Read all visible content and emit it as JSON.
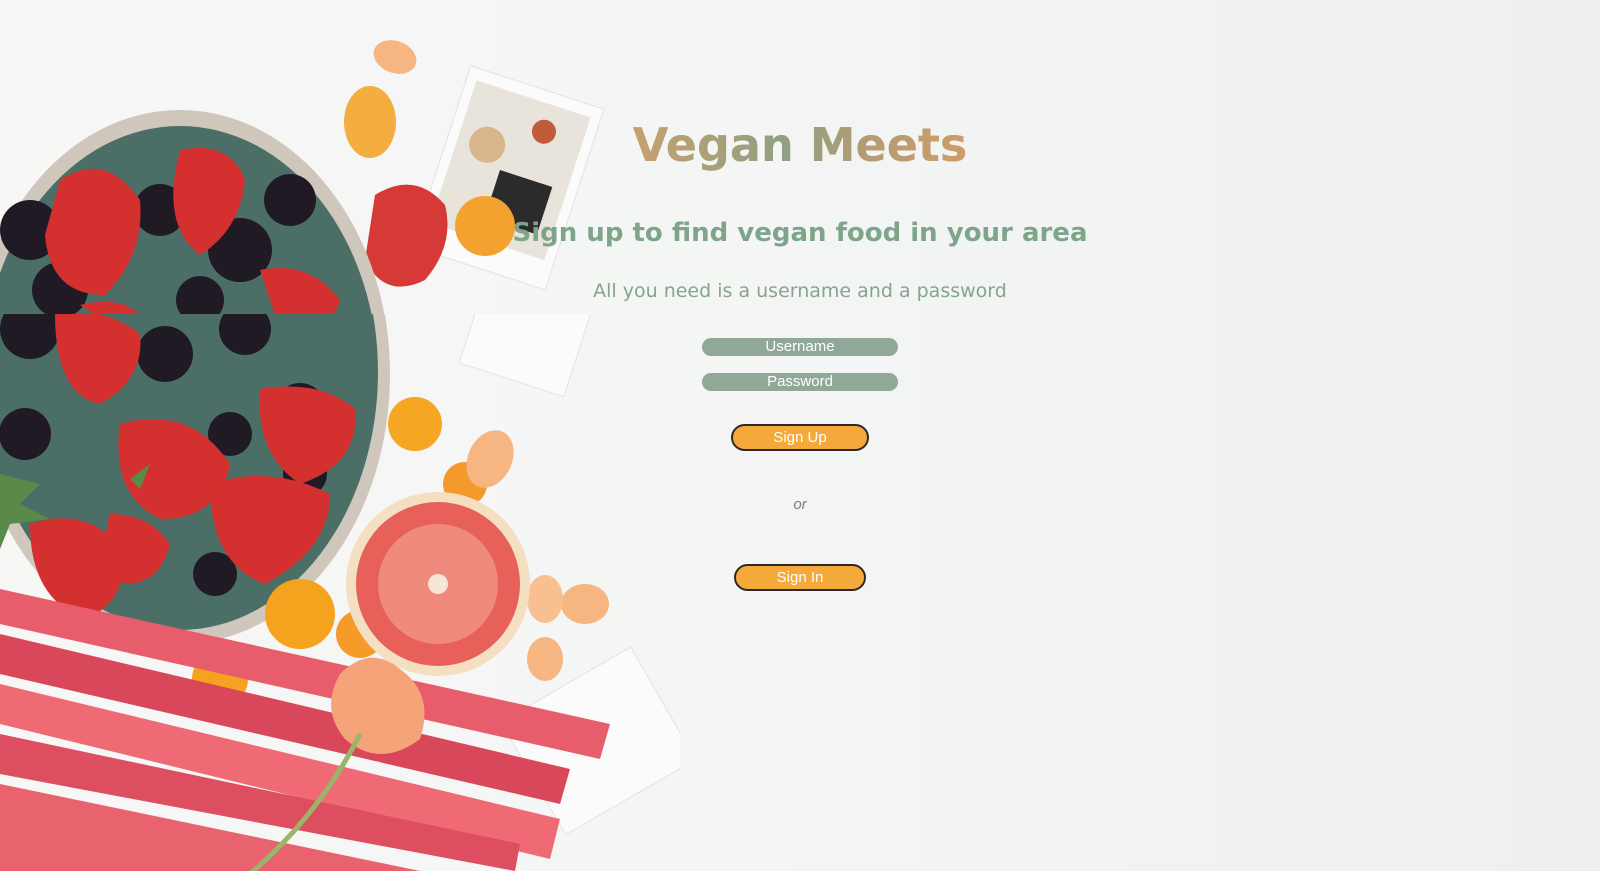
{
  "app": {
    "title": "Vegan Meets",
    "subtitle": "Sign up to find vegan food in your area",
    "lead": "All you need is a username and a password"
  },
  "form": {
    "username_placeholder": "Username",
    "password_placeholder": "Password",
    "signup_label": "Sign Up",
    "separator": "or",
    "signin_label": "Sign In"
  },
  "background": {
    "image_subject": "fruit-bowl-photo"
  },
  "colors": {
    "title_gradient": [
      "#c8a06e",
      "#8fa082",
      "#cf9d66"
    ],
    "subtitle": "#7ea58a",
    "lead": "#86a38d",
    "input_background": "#8fa898",
    "button_background": "#f4a93a",
    "button_border": "#2c2a28"
  }
}
